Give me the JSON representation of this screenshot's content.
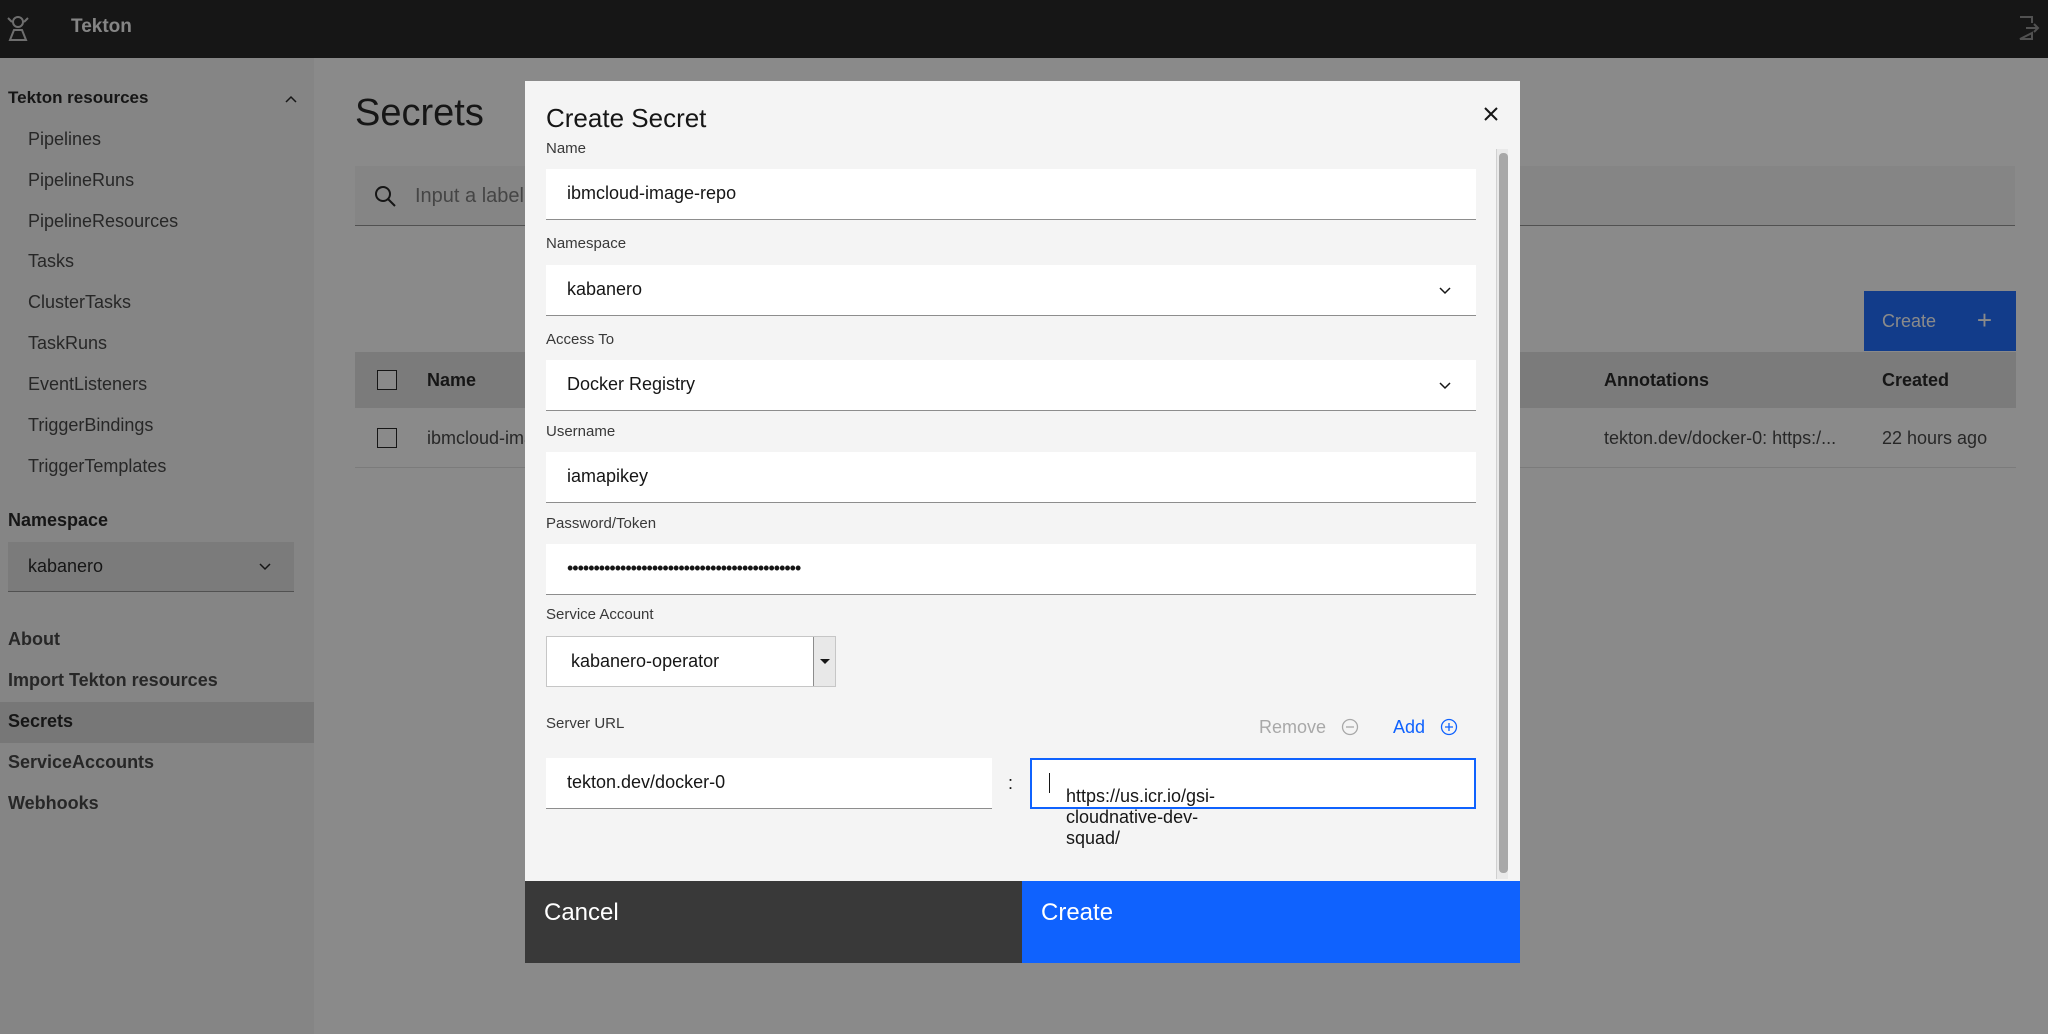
{
  "header": {
    "title": "Tekton"
  },
  "sidebar": {
    "group_title": "Tekton resources",
    "items": [
      "Pipelines",
      "PipelineRuns",
      "PipelineResources",
      "Tasks",
      "ClusterTasks",
      "TaskRuns",
      "EventListeners",
      "TriggerBindings",
      "TriggerTemplates"
    ],
    "namespace_label": "Namespace",
    "namespace_value": "kabanero",
    "links": [
      "About",
      "Import Tekton resources",
      "Secrets",
      "ServiceAccounts",
      "Webhooks"
    ],
    "active": "Secrets"
  },
  "main": {
    "title": "Secrets",
    "search_placeholder": "Input a label filter of the format labelKey:labelValue",
    "create_label": "Create",
    "create_icon": "+",
    "table": {
      "headers": [
        "Name",
        "Annotations",
        "Created"
      ],
      "rows": [
        {
          "name": "ibmcloud-image-repo",
          "annotations": "tekton.dev/docker-0: https:/...",
          "created": "22 hours ago"
        }
      ]
    }
  },
  "modal": {
    "title": "Create Secret",
    "name_label": "Name",
    "name_value": "ibmcloud-image-repo",
    "namespace_label": "Namespace",
    "namespace_value": "kabanero",
    "access_label": "Access To",
    "access_value": "Docker Registry",
    "username_label": "Username",
    "username_value": "iamapikey",
    "password_label": "Password/Token",
    "password_value": "••••••••••••••••••••••••••••••••••••••••••••",
    "sa_label": "Service Account",
    "sa_value": "kabanero-operator",
    "server_url_label": "Server URL",
    "remove_label": "Remove",
    "add_label": "Add",
    "url_key": "tekton.dev/docker-0",
    "url_sep": ":",
    "url_value": "https://us.icr.io/gsi-cloudnative-dev-squad/",
    "cancel_label": "Cancel",
    "create_label": "Create"
  }
}
